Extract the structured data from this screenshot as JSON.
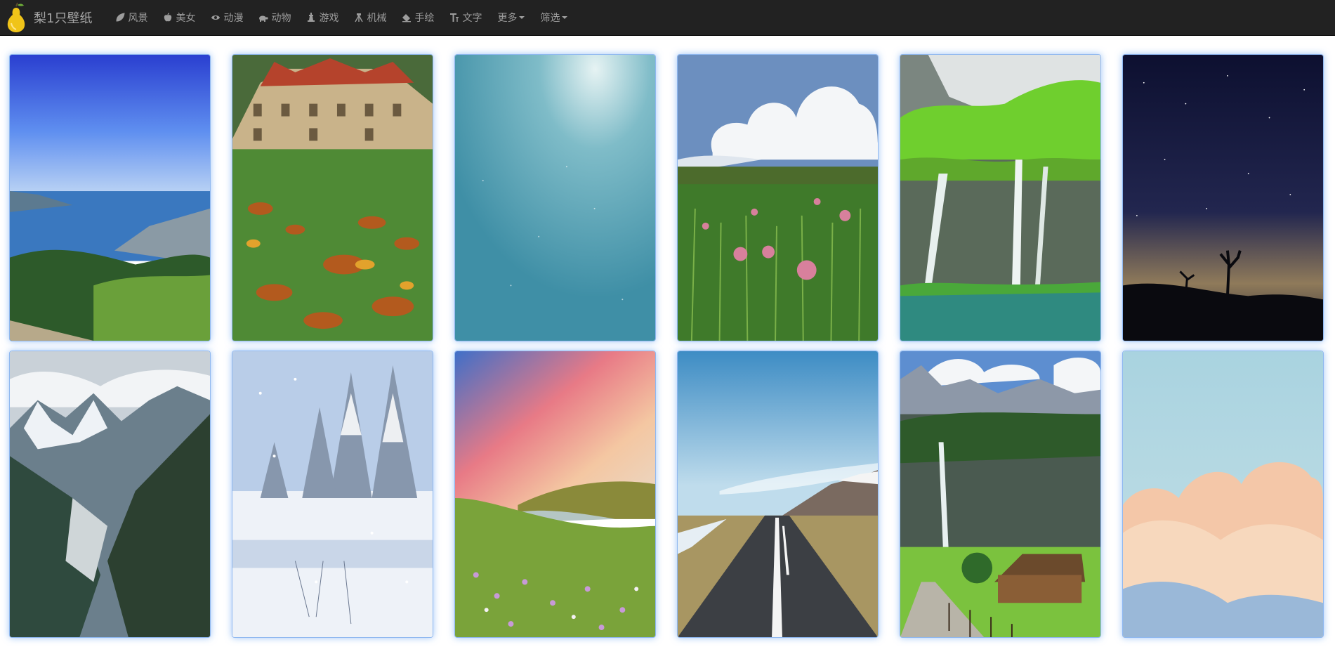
{
  "brand": {
    "name": "梨1只壁纸",
    "logo_icon": "pear-icon"
  },
  "nav": {
    "items": [
      {
        "label": "风景",
        "icon": "leaf-icon"
      },
      {
        "label": "美女",
        "icon": "apple-icon"
      },
      {
        "label": "动漫",
        "icon": "eye-icon"
      },
      {
        "label": "动物",
        "icon": "turtle-icon"
      },
      {
        "label": "游戏",
        "icon": "chess-icon"
      },
      {
        "label": "机械",
        "icon": "tripod-icon"
      },
      {
        "label": "手绘",
        "icon": "eraser-icon"
      },
      {
        "label": "文字",
        "icon": "text-icon"
      }
    ],
    "more": {
      "label": "更多"
    },
    "filter": {
      "label": "筛选"
    }
  },
  "wallpapers": [
    {
      "id": "lake-alps",
      "subject": "lake-mountain-view"
    },
    {
      "id": "castle-leaves",
      "subject": "mansion-autumn-leaves"
    },
    {
      "id": "teal-sky",
      "subject": "teal-misty-sky"
    },
    {
      "id": "poppy-field",
      "subject": "poppy-field-clouds"
    },
    {
      "id": "waterfall-green",
      "subject": "green-waterfall-lake"
    },
    {
      "id": "night-stars",
      "subject": "starry-night-joshua-tree"
    },
    {
      "id": "glacier-peaks",
      "subject": "alpine-glacier-valley"
    },
    {
      "id": "snow-forest",
      "subject": "snowy-pine-forest"
    },
    {
      "id": "sunset-meadow",
      "subject": "flower-meadow-sunset"
    },
    {
      "id": "open-road",
      "subject": "empty-road-mountains"
    },
    {
      "id": "alpine-cabin",
      "subject": "valley-waterfall-cabin"
    },
    {
      "id": "pastel-clouds",
      "subject": "pastel-cloud-sky"
    }
  ]
}
